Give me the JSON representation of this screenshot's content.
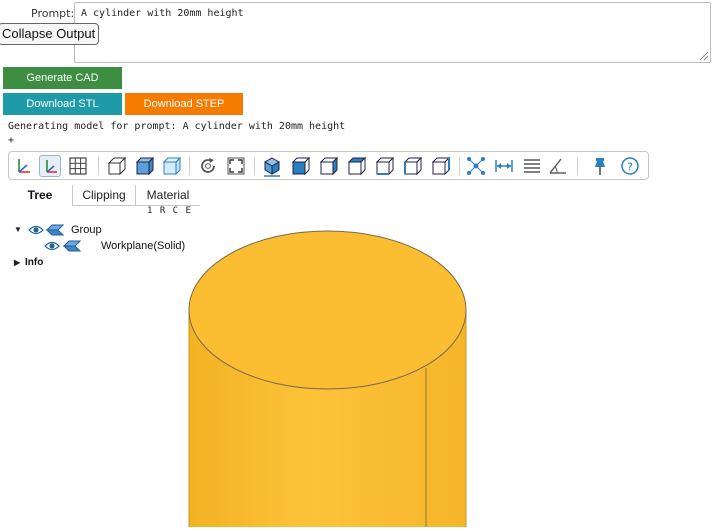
{
  "prompt": {
    "label": "Prompt:",
    "value": "A cylinder with 20mm height"
  },
  "buttons": {
    "collapse_output": "Collapse Output",
    "generate_cad": "Generate CAD",
    "download_stl": "Download STL",
    "download_step": "Download STEP"
  },
  "status": {
    "line1": "Generating model for prompt: A cylinder with 20mm height",
    "line2": "+"
  },
  "toolbar": {
    "icons": [
      "axes-icon",
      "axes-origin-icon",
      "grid-icon",
      "perspective-icon",
      "ortho-icon",
      "transparent-icon",
      "reset-icon",
      "fit-icon",
      "iso-view-icon",
      "front-view-icon",
      "rear-view-icon",
      "top-view-icon",
      "bottom-view-icon",
      "left-view-icon",
      "right-view-icon",
      "explode-icon",
      "distance-icon",
      "properties-icon",
      "angle-icon",
      "pin-icon",
      "help-icon"
    ]
  },
  "tabs": {
    "tree": "Tree",
    "clipping": "Clipping",
    "material": "Material"
  },
  "rce_header": "1 R C E",
  "tree": {
    "group": "Group",
    "workplane": "Workplane(Solid)",
    "info": "Info"
  },
  "colors": {
    "cylinder": "#f9bb2d",
    "generate": "#3e8e41",
    "stl": "#1f9aa8",
    "step": "#f57c00",
    "icon_blue": "#2a7fc1"
  }
}
